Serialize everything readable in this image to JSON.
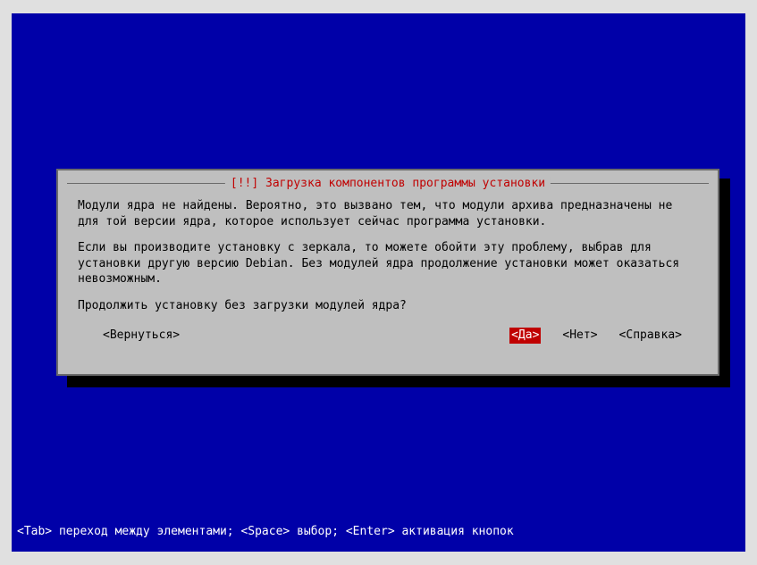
{
  "dialog": {
    "title": "[!!] Загрузка компонентов программы установки",
    "paragraph1": "Модули ядра не найдены. Вероятно, это вызвано тем, что модули архива предназначены не для той версии ядра, которое использует сейчас программа установки.",
    "paragraph2": "Если вы производите установку с зеркала, то можете обойти эту проблему, выбрав для установки другую версию Debian. Без модулей ядра продолжение установки может оказаться невозможным.",
    "question": "Продолжить установку без загрузки модулей ядра?",
    "buttons": {
      "back": "<Вернуться>",
      "yes": "<Да>",
      "no": "<Нет>",
      "help": "<Справка>"
    }
  },
  "helpbar": "<Tab> переход между элементами; <Space> выбор; <Enter> активация кнопок"
}
